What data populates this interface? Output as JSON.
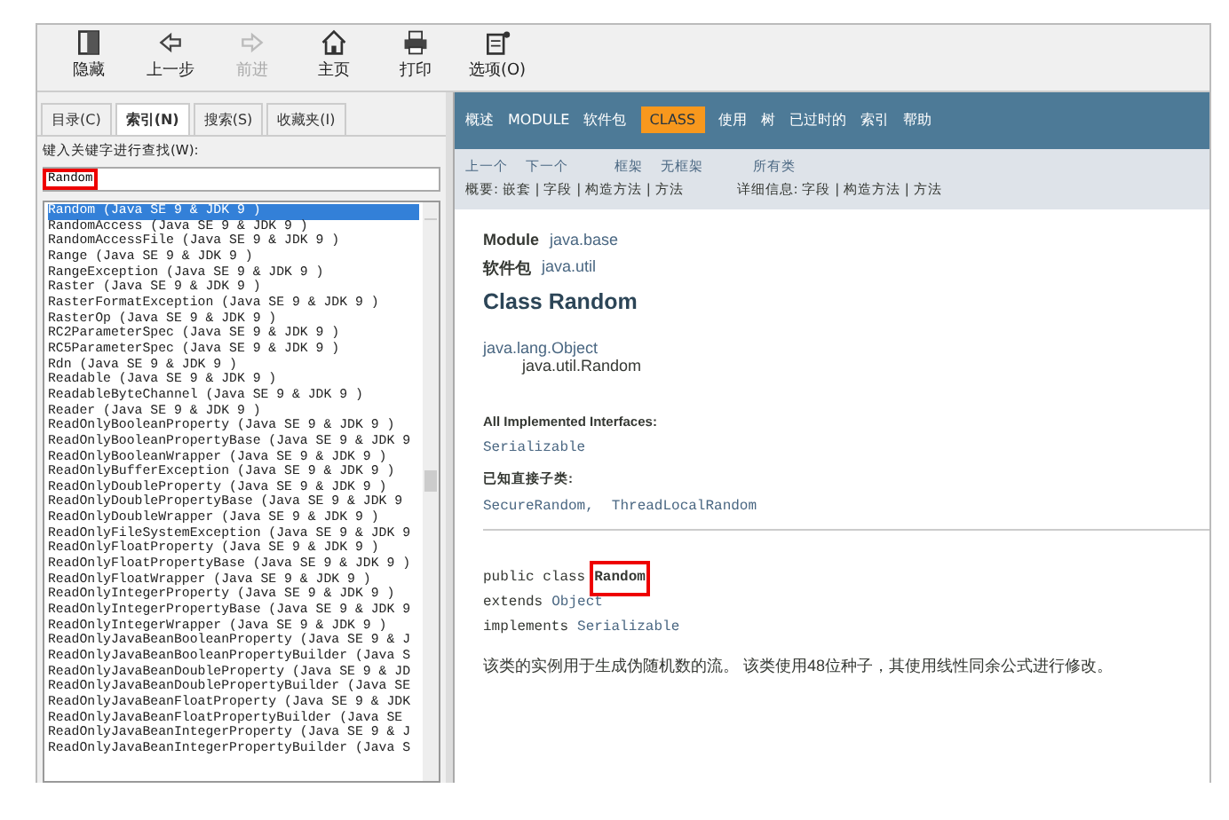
{
  "toolbar": [
    {
      "label": "隐藏",
      "disabled": false
    },
    {
      "label": "上一步",
      "disabled": false
    },
    {
      "label": "前进",
      "disabled": true
    },
    {
      "label": "主页",
      "disabled": false
    },
    {
      "label": "打印",
      "disabled": false
    },
    {
      "label": "选项(O)",
      "disabled": false
    }
  ],
  "sidebar": {
    "tabs": [
      {
        "label": "目录(C)",
        "selected": false
      },
      {
        "label": "索引(N)",
        "selected": true
      },
      {
        "label": "搜索(S)",
        "selected": false
      },
      {
        "label": "收藏夹(I)",
        "selected": false
      }
    ],
    "search_label": "键入关键字进行查找(W):",
    "search": {
      "value": "Random",
      "highlighted": true
    },
    "items": [
      {
        "text": "Random (Java SE 9 & JDK 9 )",
        "selected": true
      },
      {
        "text": "RandomAccess (Java SE 9 & JDK 9 )",
        "selected": false
      },
      {
        "text": "RandomAccessFile (Java SE 9 & JDK 9 )",
        "selected": false
      },
      {
        "text": "Range (Java SE 9 & JDK 9 )",
        "selected": false
      },
      {
        "text": "RangeException (Java SE 9 & JDK 9 )",
        "selected": false
      },
      {
        "text": "Raster (Java SE 9 & JDK 9 )",
        "selected": false
      },
      {
        "text": "RasterFormatException (Java SE 9 & JDK 9 )",
        "selected": false
      },
      {
        "text": "RasterOp (Java SE 9 & JDK 9 )",
        "selected": false
      },
      {
        "text": "RC2ParameterSpec (Java SE 9 & JDK 9 )",
        "selected": false
      },
      {
        "text": "RC5ParameterSpec (Java SE 9 & JDK 9 )",
        "selected": false
      },
      {
        "text": "Rdn (Java SE 9 & JDK 9 )",
        "selected": false
      },
      {
        "text": "Readable (Java SE 9 & JDK 9 )",
        "selected": false
      },
      {
        "text": "ReadableByteChannel (Java SE 9 & JDK 9 )",
        "selected": false
      },
      {
        "text": "Reader (Java SE 9 & JDK 9 )",
        "selected": false
      },
      {
        "text": "ReadOnlyBooleanProperty (Java SE 9 & JDK 9 )",
        "selected": false
      },
      {
        "text": "ReadOnlyBooleanPropertyBase (Java SE 9 & JDK 9",
        "selected": false
      },
      {
        "text": "ReadOnlyBooleanWrapper (Java SE 9 & JDK 9 )",
        "selected": false
      },
      {
        "text": "ReadOnlyBufferException (Java SE 9 & JDK 9 )",
        "selected": false
      },
      {
        "text": "ReadOnlyDoubleProperty (Java SE 9 & JDK 9 )",
        "selected": false
      },
      {
        "text": "ReadOnlyDoublePropertyBase (Java SE 9 & JDK 9",
        "selected": false
      },
      {
        "text": "ReadOnlyDoubleWrapper (Java SE 9 & JDK 9 )",
        "selected": false
      },
      {
        "text": "ReadOnlyFileSystemException (Java SE 9 & JDK 9",
        "selected": false
      },
      {
        "text": "ReadOnlyFloatProperty (Java SE 9 & JDK 9 )",
        "selected": false
      },
      {
        "text": "ReadOnlyFloatPropertyBase (Java SE 9 & JDK 9 )",
        "selected": false
      },
      {
        "text": "ReadOnlyFloatWrapper (Java SE 9 & JDK 9 )",
        "selected": false
      },
      {
        "text": "ReadOnlyIntegerProperty (Java SE 9 & JDK 9 )",
        "selected": false
      },
      {
        "text": "ReadOnlyIntegerPropertyBase (Java SE 9 & JDK 9",
        "selected": false
      },
      {
        "text": "ReadOnlyIntegerWrapper (Java SE 9 & JDK 9 )",
        "selected": false
      },
      {
        "text": "ReadOnlyJavaBeanBooleanProperty (Java SE 9 & J",
        "selected": false
      },
      {
        "text": "ReadOnlyJavaBeanBooleanPropertyBuilder (Java S",
        "selected": false
      },
      {
        "text": "ReadOnlyJavaBeanDoubleProperty (Java SE 9 & JD",
        "selected": false
      },
      {
        "text": "ReadOnlyJavaBeanDoublePropertyBuilder (Java SE",
        "selected": false
      },
      {
        "text": "ReadOnlyJavaBeanFloatProperty (Java SE 9 & JDK",
        "selected": false
      },
      {
        "text": "ReadOnlyJavaBeanFloatPropertyBuilder (Java SE",
        "selected": false
      },
      {
        "text": "ReadOnlyJavaBeanIntegerProperty (Java SE 9 & J",
        "selected": false
      },
      {
        "text": "ReadOnlyJavaBeanIntegerPropertyBuilder (Java S",
        "selected": false
      }
    ]
  },
  "nav": [
    {
      "label": "概述",
      "selected": false
    },
    {
      "label": "MODULE",
      "selected": false
    },
    {
      "label": "软件包",
      "selected": false
    },
    {
      "label": "CLASS",
      "selected": true
    },
    {
      "label": "使用",
      "selected": false
    },
    {
      "label": "树",
      "selected": false
    },
    {
      "label": "已过时的",
      "selected": false
    },
    {
      "label": "索引",
      "selected": false
    },
    {
      "label": "帮助",
      "selected": false
    }
  ],
  "subnav": {
    "row_1": [
      "上一个",
      "下一个",
      "框架",
      "无框架",
      "所有类"
    ],
    "summary": "概要: 嵌套 | 字段 | 构造方法 | 方法",
    "detail": "详细信息: 字段 | 构造方法 | 方法"
  },
  "content": {
    "module_label": "Module",
    "module": "java.base",
    "package_label": "软件包",
    "package": "java.util",
    "title": "Class Random",
    "hierarchy": [
      "java.lang.Object",
      "java.util.Random"
    ],
    "interfaces_label": "All Implemented Interfaces:",
    "interfaces": "Serializable",
    "subclasses_label": "已知直接子类:",
    "subclasses": [
      "SecureRandom,",
      "ThreadLocalRandom"
    ],
    "decl_prefix": "public class",
    "decl_name": "Random",
    "decl_highlighted": true,
    "extends_label": "extends",
    "extends": "Object",
    "implements_label": "implements",
    "implements": "Serializable",
    "description": "该类的实例用于生成伪随机数的流。 该类使用48位种子，其使用线性同余公式进行修改。"
  }
}
